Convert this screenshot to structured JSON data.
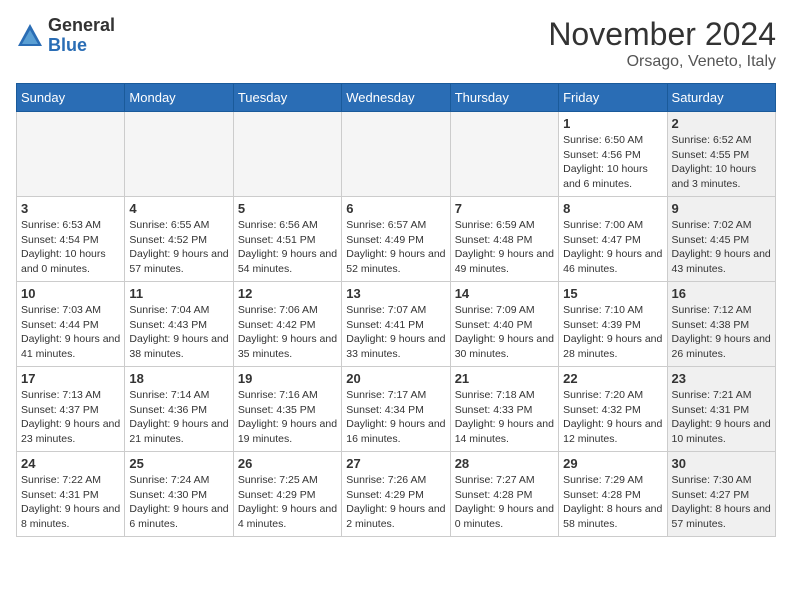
{
  "header": {
    "logo_general": "General",
    "logo_blue": "Blue",
    "month_year": "November 2024",
    "location": "Orsago, Veneto, Italy"
  },
  "weekdays": [
    "Sunday",
    "Monday",
    "Tuesday",
    "Wednesday",
    "Thursday",
    "Friday",
    "Saturday"
  ],
  "weeks": [
    [
      {
        "day": "",
        "info": "",
        "empty": true
      },
      {
        "day": "",
        "info": "",
        "empty": true
      },
      {
        "day": "",
        "info": "",
        "empty": true
      },
      {
        "day": "",
        "info": "",
        "empty": true
      },
      {
        "day": "",
        "info": "",
        "empty": true
      },
      {
        "day": "1",
        "info": "Sunrise: 6:50 AM\nSunset: 4:56 PM\nDaylight: 10 hours\nand 6 minutes.",
        "shaded": false
      },
      {
        "day": "2",
        "info": "Sunrise: 6:52 AM\nSunset: 4:55 PM\nDaylight: 10 hours\nand 3 minutes.",
        "shaded": true
      }
    ],
    [
      {
        "day": "3",
        "info": "Sunrise: 6:53 AM\nSunset: 4:54 PM\nDaylight: 10 hours\nand 0 minutes.",
        "shaded": false
      },
      {
        "day": "4",
        "info": "Sunrise: 6:55 AM\nSunset: 4:52 PM\nDaylight: 9 hours\nand 57 minutes.",
        "shaded": false
      },
      {
        "day": "5",
        "info": "Sunrise: 6:56 AM\nSunset: 4:51 PM\nDaylight: 9 hours\nand 54 minutes.",
        "shaded": false
      },
      {
        "day": "6",
        "info": "Sunrise: 6:57 AM\nSunset: 4:49 PM\nDaylight: 9 hours\nand 52 minutes.",
        "shaded": false
      },
      {
        "day": "7",
        "info": "Sunrise: 6:59 AM\nSunset: 4:48 PM\nDaylight: 9 hours\nand 49 minutes.",
        "shaded": false
      },
      {
        "day": "8",
        "info": "Sunrise: 7:00 AM\nSunset: 4:47 PM\nDaylight: 9 hours\nand 46 minutes.",
        "shaded": false
      },
      {
        "day": "9",
        "info": "Sunrise: 7:02 AM\nSunset: 4:45 PM\nDaylight: 9 hours\nand 43 minutes.",
        "shaded": true
      }
    ],
    [
      {
        "day": "10",
        "info": "Sunrise: 7:03 AM\nSunset: 4:44 PM\nDaylight: 9 hours\nand 41 minutes.",
        "shaded": false
      },
      {
        "day": "11",
        "info": "Sunrise: 7:04 AM\nSunset: 4:43 PM\nDaylight: 9 hours\nand 38 minutes.",
        "shaded": false
      },
      {
        "day": "12",
        "info": "Sunrise: 7:06 AM\nSunset: 4:42 PM\nDaylight: 9 hours\nand 35 minutes.",
        "shaded": false
      },
      {
        "day": "13",
        "info": "Sunrise: 7:07 AM\nSunset: 4:41 PM\nDaylight: 9 hours\nand 33 minutes.",
        "shaded": false
      },
      {
        "day": "14",
        "info": "Sunrise: 7:09 AM\nSunset: 4:40 PM\nDaylight: 9 hours\nand 30 minutes.",
        "shaded": false
      },
      {
        "day": "15",
        "info": "Sunrise: 7:10 AM\nSunset: 4:39 PM\nDaylight: 9 hours\nand 28 minutes.",
        "shaded": false
      },
      {
        "day": "16",
        "info": "Sunrise: 7:12 AM\nSunset: 4:38 PM\nDaylight: 9 hours\nand 26 minutes.",
        "shaded": true
      }
    ],
    [
      {
        "day": "17",
        "info": "Sunrise: 7:13 AM\nSunset: 4:37 PM\nDaylight: 9 hours\nand 23 minutes.",
        "shaded": false
      },
      {
        "day": "18",
        "info": "Sunrise: 7:14 AM\nSunset: 4:36 PM\nDaylight: 9 hours\nand 21 minutes.",
        "shaded": false
      },
      {
        "day": "19",
        "info": "Sunrise: 7:16 AM\nSunset: 4:35 PM\nDaylight: 9 hours\nand 19 minutes.",
        "shaded": false
      },
      {
        "day": "20",
        "info": "Sunrise: 7:17 AM\nSunset: 4:34 PM\nDaylight: 9 hours\nand 16 minutes.",
        "shaded": false
      },
      {
        "day": "21",
        "info": "Sunrise: 7:18 AM\nSunset: 4:33 PM\nDaylight: 9 hours\nand 14 minutes.",
        "shaded": false
      },
      {
        "day": "22",
        "info": "Sunrise: 7:20 AM\nSunset: 4:32 PM\nDaylight: 9 hours\nand 12 minutes.",
        "shaded": false
      },
      {
        "day": "23",
        "info": "Sunrise: 7:21 AM\nSunset: 4:31 PM\nDaylight: 9 hours\nand 10 minutes.",
        "shaded": true
      }
    ],
    [
      {
        "day": "24",
        "info": "Sunrise: 7:22 AM\nSunset: 4:31 PM\nDaylight: 9 hours\nand 8 minutes.",
        "shaded": false
      },
      {
        "day": "25",
        "info": "Sunrise: 7:24 AM\nSunset: 4:30 PM\nDaylight: 9 hours\nand 6 minutes.",
        "shaded": false
      },
      {
        "day": "26",
        "info": "Sunrise: 7:25 AM\nSunset: 4:29 PM\nDaylight: 9 hours\nand 4 minutes.",
        "shaded": false
      },
      {
        "day": "27",
        "info": "Sunrise: 7:26 AM\nSunset: 4:29 PM\nDaylight: 9 hours\nand 2 minutes.",
        "shaded": false
      },
      {
        "day": "28",
        "info": "Sunrise: 7:27 AM\nSunset: 4:28 PM\nDaylight: 9 hours\nand 0 minutes.",
        "shaded": false
      },
      {
        "day": "29",
        "info": "Sunrise: 7:29 AM\nSunset: 4:28 PM\nDaylight: 8 hours\nand 58 minutes.",
        "shaded": false
      },
      {
        "day": "30",
        "info": "Sunrise: 7:30 AM\nSunset: 4:27 PM\nDaylight: 8 hours\nand 57 minutes.",
        "shaded": true
      }
    ]
  ]
}
